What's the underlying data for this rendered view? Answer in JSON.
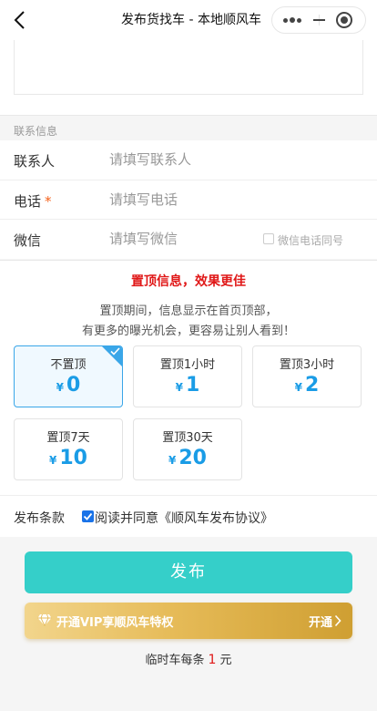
{
  "navbar": {
    "title": "发布货找车 - 本地顺风车"
  },
  "contact_section": {
    "heading": "联系信息",
    "contact": {
      "label": "联系人",
      "placeholder": "请填写联系人"
    },
    "phone": {
      "label": "电话",
      "required_mark": "*",
      "placeholder": "请填写电话"
    },
    "wechat": {
      "label": "微信",
      "placeholder": "请填写微信",
      "same_as_phone_label": "微信电话同号"
    }
  },
  "top_promo": {
    "title": "置顶信息，效果更佳",
    "desc_line1": "置顶期间，信息显示在首页顶部，",
    "desc_line2": "有更多的曝光机会，更容易让别人看到！",
    "currency": "¥",
    "options": [
      {
        "label": "不置顶",
        "price": "0",
        "selected": true
      },
      {
        "label": "置顶1小时",
        "price": "1",
        "selected": false
      },
      {
        "label": "置顶3小时",
        "price": "2",
        "selected": false
      },
      {
        "label": "置顶7天",
        "price": "10",
        "selected": false
      },
      {
        "label": "置顶30天",
        "price": "20",
        "selected": false
      }
    ]
  },
  "terms": {
    "label": "发布条款",
    "agree_text": "阅读并同意《顺风车发布协议》",
    "checked": true
  },
  "publish_button": "发布",
  "vip": {
    "text": "开通VIP享顺风车特权",
    "open_label": "开通"
  },
  "fee": {
    "prefix": "临时车每条",
    "amount": "1",
    "suffix": "元"
  },
  "colors": {
    "accent_red": "#e01818",
    "price_blue": "#1a9ce6",
    "publish_teal": "#35cfc9",
    "vip_gold": "#e6bb58"
  }
}
